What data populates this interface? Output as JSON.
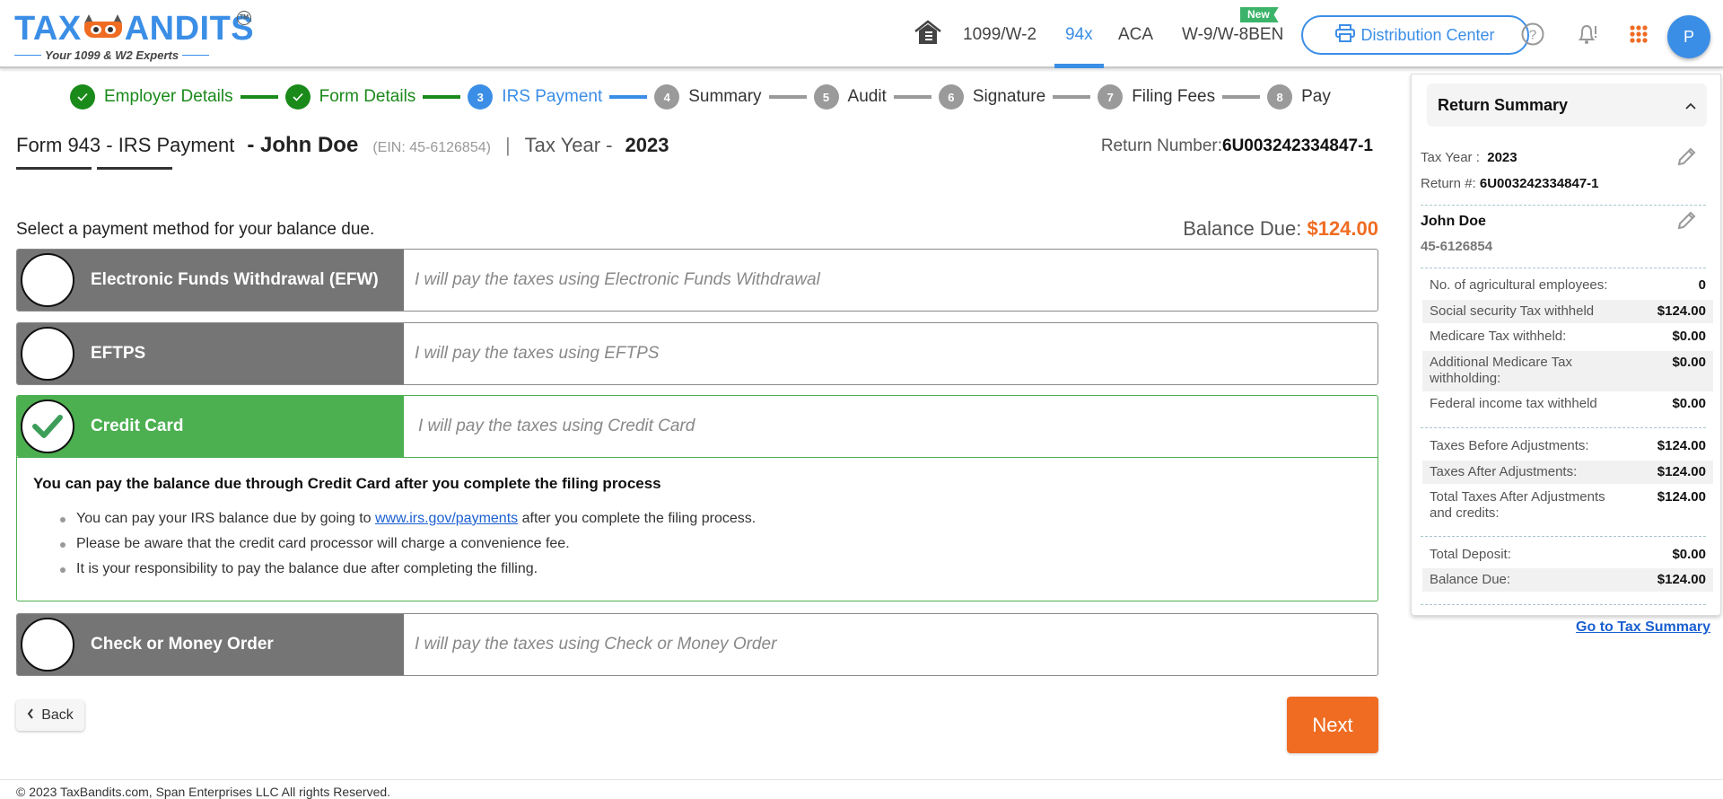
{
  "header": {
    "logo_text_left": "TAX",
    "logo_text_right": "ANDITS",
    "logo_trademark": "TM",
    "logo_tagline": "Your 1099 & W2 Experts",
    "nav": [
      {
        "label": "1099/W-2",
        "active": false
      },
      {
        "label": "94x",
        "active": true
      },
      {
        "label": "ACA",
        "active": false
      },
      {
        "label": "W-9/W-8BEN",
        "active": false
      }
    ],
    "new_badge": "New",
    "distribution_center_label": "Distribution Center",
    "avatar_initial": "P",
    "icons": [
      "home-icon",
      "printer-icon",
      "help-icon",
      "bell-icon",
      "apps-grid-icon"
    ],
    "accent_color": "#3b8ee6",
    "orange_color": "#ef6c22"
  },
  "stepper": {
    "steps": [
      {
        "number": "1",
        "label": "Employer Details",
        "status": "done"
      },
      {
        "number": "2",
        "label": "Form Details",
        "status": "done"
      },
      {
        "number": "3",
        "label": "IRS Payment",
        "status": "active"
      },
      {
        "number": "4",
        "label": "Summary",
        "status": "todo"
      },
      {
        "number": "5",
        "label": "Audit",
        "status": "todo"
      },
      {
        "number": "6",
        "label": "Signature",
        "status": "todo"
      },
      {
        "number": "7",
        "label": "Filing Fees",
        "status": "todo"
      },
      {
        "number": "8",
        "label": "Pay",
        "status": "todo"
      }
    ]
  },
  "form": {
    "title": "Form 943 - IRS Payment",
    "name": "- John Doe",
    "ein": "(EIN: 45-6126854)",
    "separator": "|",
    "tax_year_label": "Tax Year -",
    "tax_year": "2023",
    "return_number_label": "Return Number:",
    "return_number": "6U003242334847-1",
    "select_label": "Select a payment method for your balance due.",
    "balance_due_label": "Balance Due:",
    "balance_due": "$124.00"
  },
  "payment_options": [
    {
      "title": "Electronic Funds Withdrawal (EFW)",
      "description": "I will pay the taxes using Electronic Funds Withdrawal",
      "selected": false
    },
    {
      "title": "EFTPS",
      "description": "I will pay the taxes using EFTPS",
      "selected": false
    },
    {
      "title": "Credit Card",
      "description": "I will pay the taxes using Credit Card",
      "selected": true
    },
    {
      "title": "Check or Money Order",
      "description": "I will pay the taxes using Check or Money Order",
      "selected": false
    }
  ],
  "credit_card_detail": {
    "heading": "You can pay the balance due through Credit Card after you complete the filing process",
    "bullet1_before": "You can pay your IRS balance due by going to ",
    "bullet1_link": "www.irs.gov/payments",
    "bullet1_after": " after you complete the filing process.",
    "bullet2": "Please be aware that the credit card processor will charge a convenience fee.",
    "bullet3": "It is your responsibility to pay the balance due after completing the filling."
  },
  "actions": {
    "back_label": "Back",
    "next_label": "Next"
  },
  "footer": {
    "copyright": "© 2023 TaxBandits.com, Span Enterprises LLC All rights Reserved."
  },
  "summary": {
    "title": "Return Summary",
    "tax_year_label": "Tax Year :",
    "tax_year": "2023",
    "return_label": "Return #:",
    "return_number": "6U003242334847-1",
    "employer_name": "John Doe",
    "employer_ein": "45-6126854",
    "group1": [
      {
        "label": "No. of agricultural employees:",
        "value": "0",
        "shaded": false
      },
      {
        "label": "Social security Tax withheld",
        "value": "$124.00",
        "shaded": true
      },
      {
        "label": "Medicare Tax withheld:",
        "value": "$0.00",
        "shaded": false
      },
      {
        "label": "Additional Medicare Tax withholding:",
        "value": "$0.00",
        "shaded": true
      },
      {
        "label": "Federal income tax withheld",
        "value": "$0.00",
        "shaded": false
      }
    ],
    "group2": [
      {
        "label": "Taxes Before Adjustments:",
        "value": "$124.00",
        "shaded": false
      },
      {
        "label": "Taxes After Adjustments:",
        "value": "$124.00",
        "shaded": true
      },
      {
        "label": "Total Taxes After Adjustments and credits:",
        "value": "$124.00",
        "shaded": false
      }
    ],
    "group3": [
      {
        "label": "Total Deposit:",
        "value": "$0.00",
        "shaded": false
      },
      {
        "label": "Balance Due:",
        "value": "$124.00",
        "shaded": true
      }
    ],
    "go_to_link": "Go to Tax Summary"
  }
}
